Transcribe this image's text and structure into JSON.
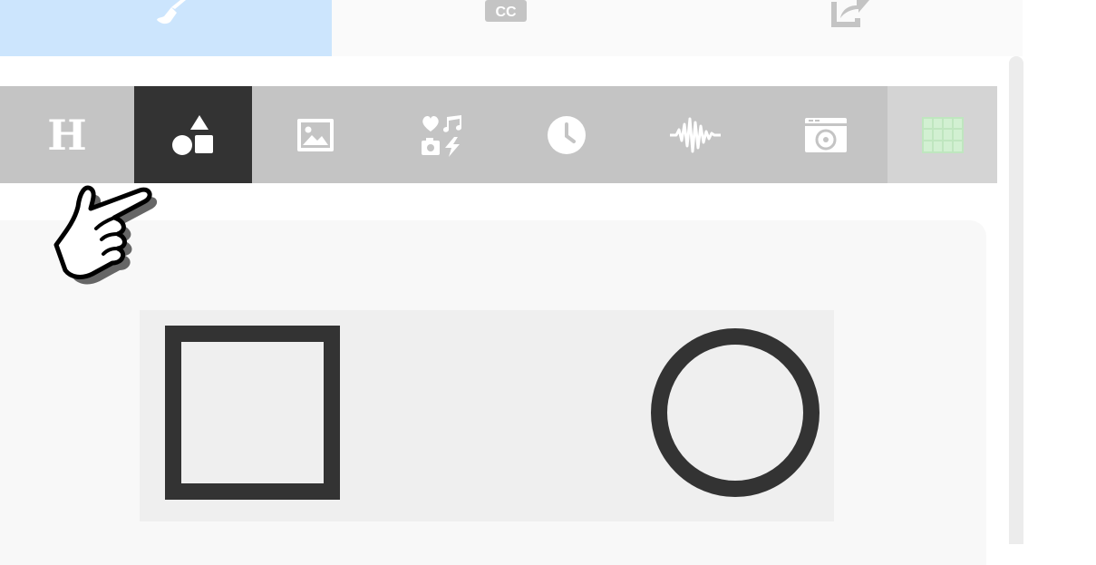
{
  "top_tabs": [
    {
      "name": "design",
      "icon": "paintbrush-icon",
      "active": true
    },
    {
      "name": "captions",
      "icon": "cc-icon",
      "active": false
    },
    {
      "name": "export",
      "icon": "share-icon",
      "active": false
    }
  ],
  "tool_tabs": [
    {
      "name": "heading",
      "icon": "heading-icon",
      "glyph": "H",
      "active": false
    },
    {
      "name": "shapes",
      "icon": "shapes-icon",
      "active": true
    },
    {
      "name": "image",
      "icon": "image-icon",
      "active": false
    },
    {
      "name": "media",
      "icon": "media-icon",
      "active": false
    },
    {
      "name": "clock",
      "icon": "clock-icon",
      "active": false
    },
    {
      "name": "audio",
      "icon": "audio-wave-icon",
      "active": false
    },
    {
      "name": "camera",
      "icon": "camera-icon",
      "active": false
    },
    {
      "name": "grid",
      "icon": "grid-icon",
      "active": false
    }
  ],
  "shapes": [
    {
      "name": "square",
      "icon": "square-shape"
    },
    {
      "name": "circle",
      "icon": "circle-shape"
    }
  ],
  "colors": {
    "active_tab": "#cce5fd",
    "toolbar": "#c4c4c4",
    "toolbar_active": "#333333",
    "grid_icon": "#d2f0d2",
    "shape_stroke": "#333333"
  }
}
